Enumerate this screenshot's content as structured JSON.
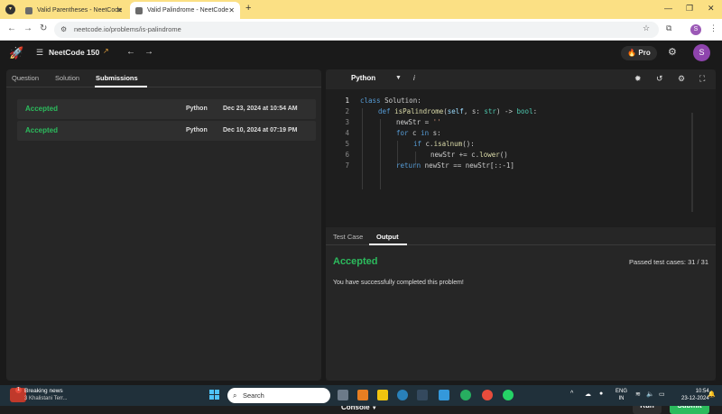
{
  "browser": {
    "tabs": [
      {
        "title": "Valid Parentheses - NeetCode"
      },
      {
        "title": "Valid Palindrome - NeetCode"
      }
    ],
    "url": "neetcode.io/problems/is-palindrome"
  },
  "header": {
    "brand": "NeetCode 150",
    "pro_label": "Pro",
    "avatar_letter": "S"
  },
  "left": {
    "tabs": [
      "Question",
      "Solution",
      "Submissions"
    ],
    "active_tab": "Submissions",
    "submissions": [
      {
        "status": "Accepted",
        "language": "Python",
        "date": "Dec 23, 2024 at 10:54 AM"
      },
      {
        "status": "Accepted",
        "language": "Python",
        "date": "Dec 10, 2024 at 07:19 PM"
      }
    ]
  },
  "editor": {
    "language": "Python",
    "info": "i",
    "lines": [
      {
        "n": "1"
      },
      {
        "n": "2"
      },
      {
        "n": "3"
      },
      {
        "n": "4"
      },
      {
        "n": "5"
      },
      {
        "n": "6"
      },
      {
        "n": "7"
      }
    ],
    "code": {
      "l1_kw": "class",
      "l1_rest": " Solution:",
      "l2_kw": "def",
      "l2_fn": "isPalindrome",
      "l2_p1": "(",
      "l2_self": "self",
      "l2_p2": ", s: ",
      "l2_ty1": "str",
      "l2_p3": ") -> ",
      "l2_ty2": "bool",
      "l2_p4": ":",
      "l3_a": "newStr = ",
      "l3_str": "''",
      "l4_kw": "for",
      "l4_a": " c ",
      "l4_kw2": "in",
      "l4_b": " s:",
      "l5_kw": "if",
      "l5_a": " c.",
      "l5_fn": "isalnum",
      "l5_b": "():",
      "l6_a": "newStr += c.",
      "l6_fn": "lower",
      "l6_b": "()",
      "l7_kw": "return",
      "l7_a": " newStr == newStr[::-1]"
    }
  },
  "output": {
    "tabs": [
      "Test Case",
      "Output"
    ],
    "active_tab": "Output",
    "status": "Accepted",
    "passed": "Passed test cases: 31 / 31",
    "message": "You have successfully completed this problem!"
  },
  "footer": {
    "console_label": "Console",
    "run_label": "Run",
    "submit_label": "Submit"
  },
  "taskbar": {
    "news_title": "Breaking news",
    "news_sub": "3 Khalistani Terr...",
    "news_badge": "1",
    "search_placeholder": "Search",
    "lang_line1": "ENG",
    "lang_line2": "IN",
    "time": "10:54",
    "date": "23-12-2024"
  }
}
